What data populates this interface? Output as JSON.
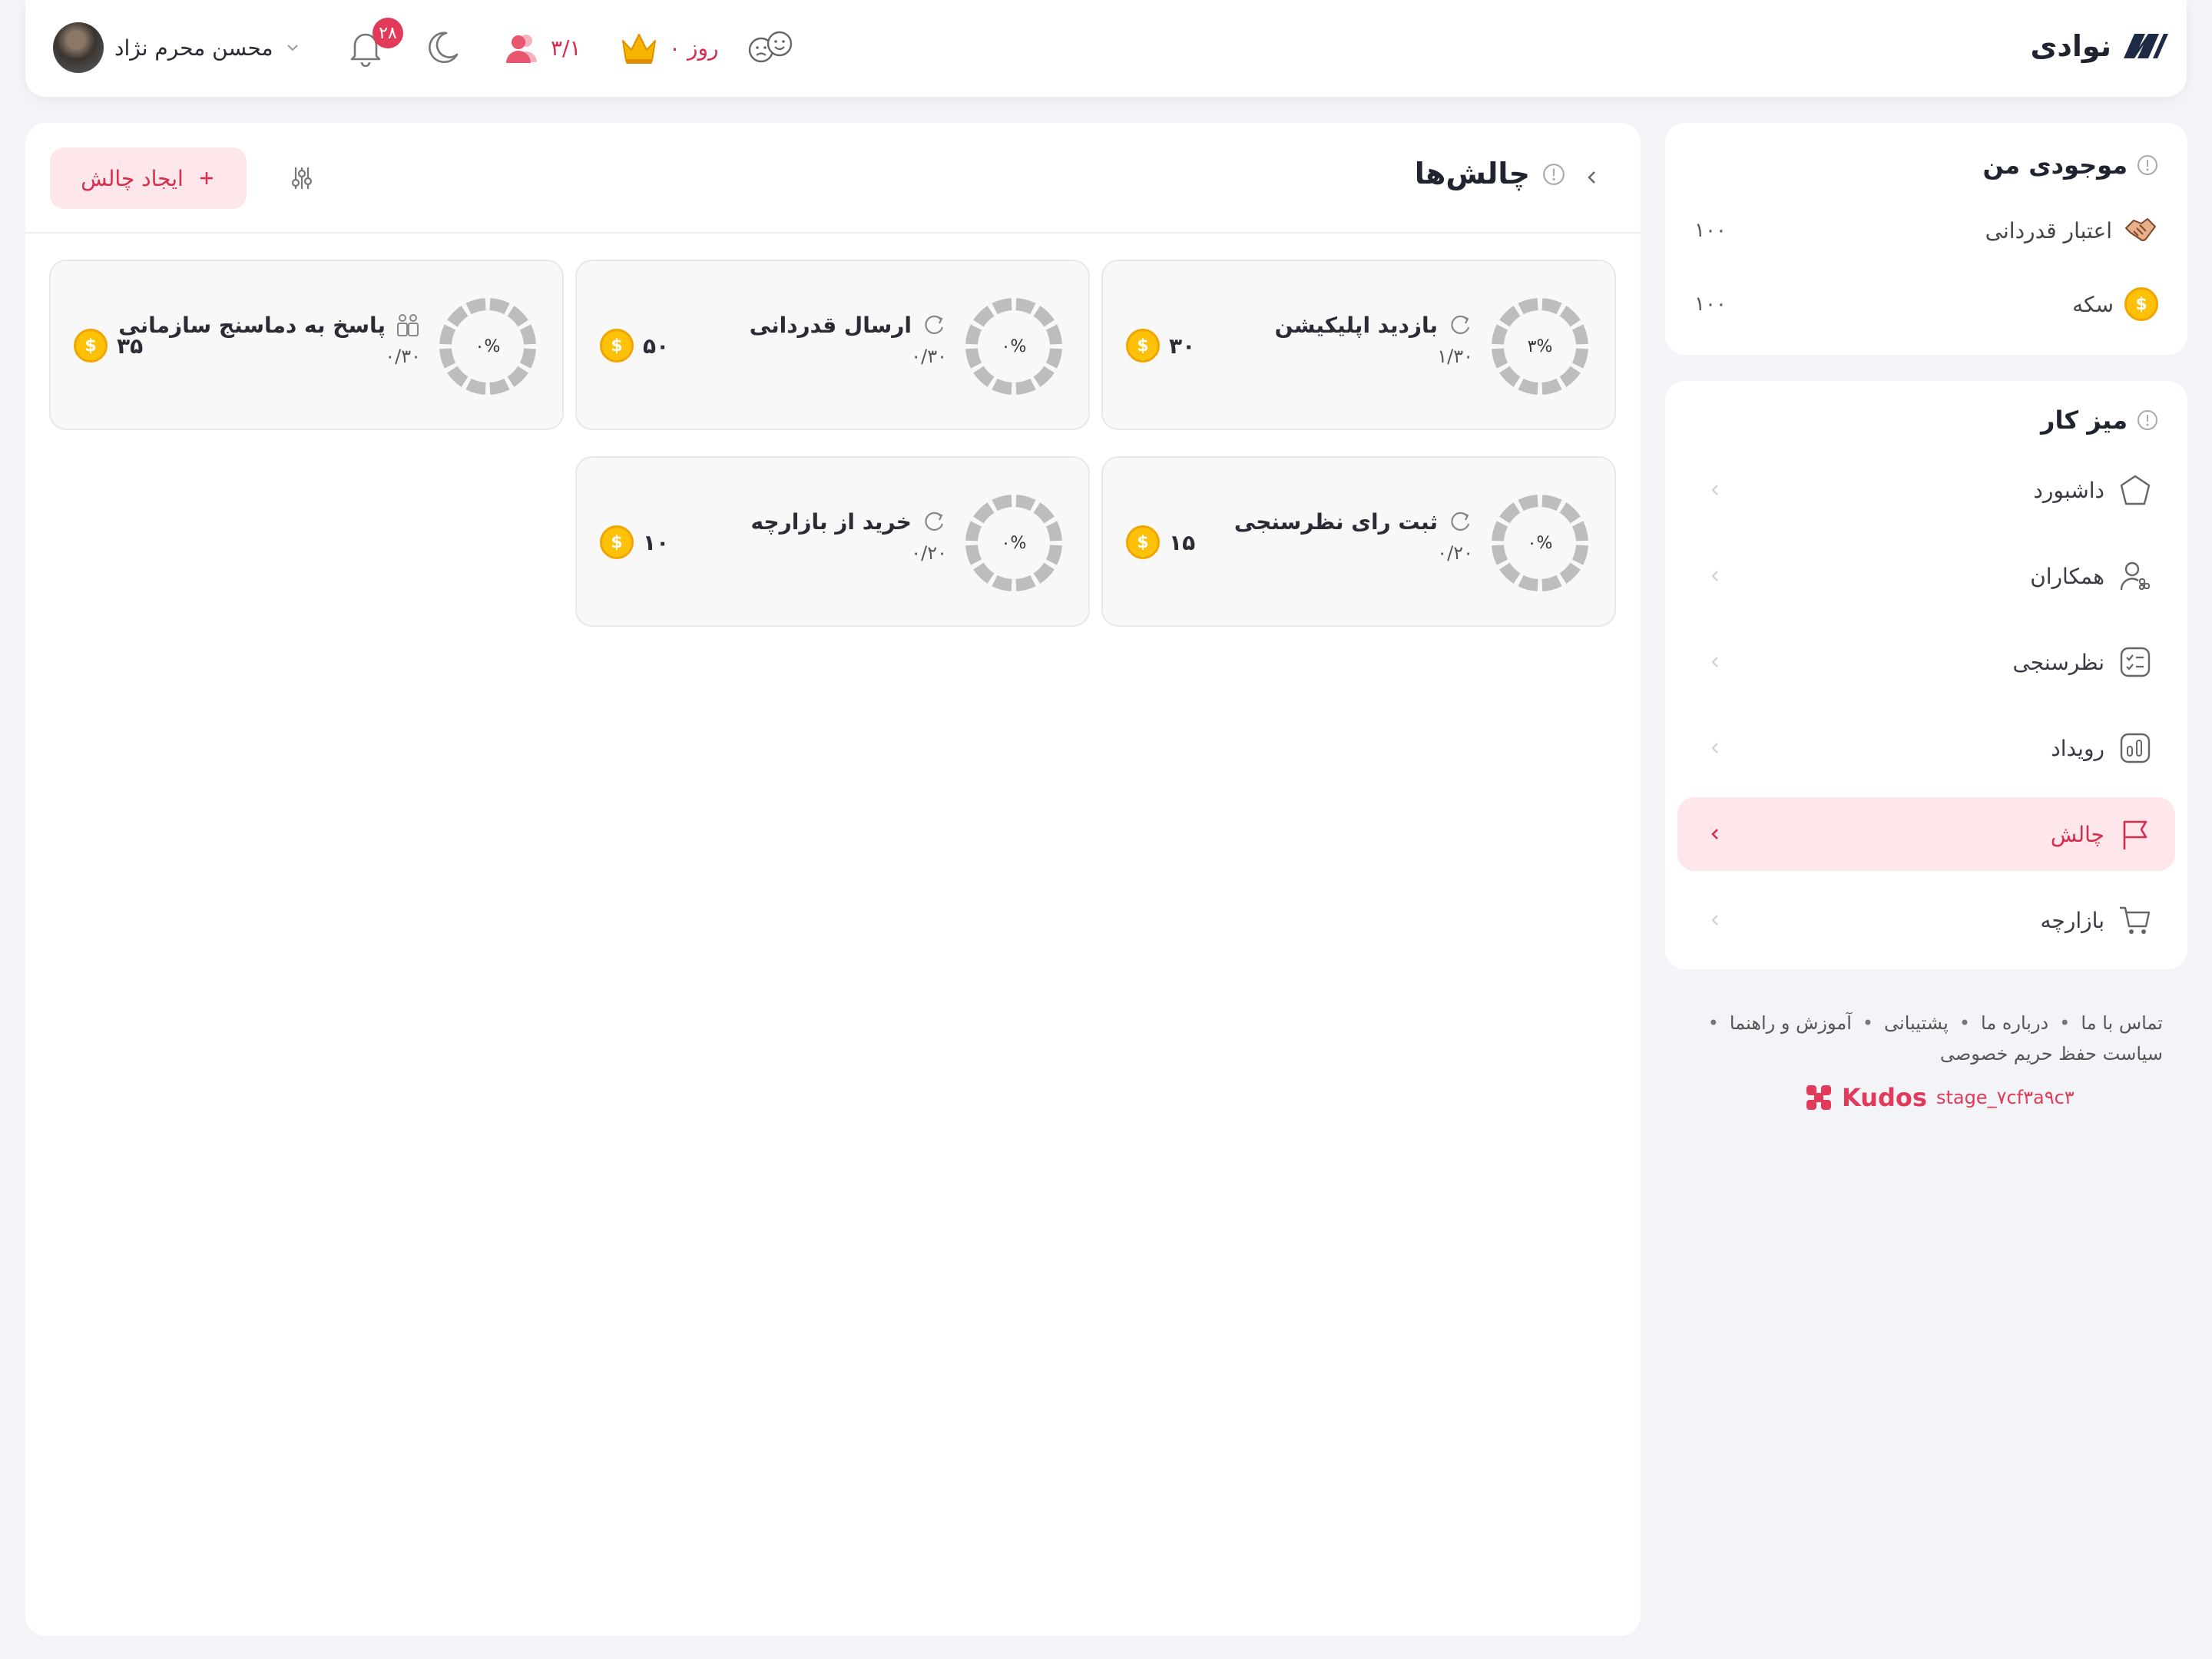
{
  "brand": {
    "name": "نوادی",
    "logo_color": "#1f2a44"
  },
  "header": {
    "user_name": "محسن محرم نژاد",
    "notifications_count": "۲۸",
    "followers": "۳/۱",
    "streak": "۰ روز"
  },
  "inventory": {
    "title": "موجودی من",
    "items": [
      {
        "label": "اعتبار قدردانی",
        "value": "۱۰۰",
        "icon": "handshake-icon"
      },
      {
        "label": "سکه",
        "value": "۱۰۰",
        "icon": "coin-icon"
      }
    ]
  },
  "workspace": {
    "title": "میز کار",
    "items": [
      {
        "label": "داشبورد",
        "icon": "home-icon"
      },
      {
        "label": "همکاران",
        "icon": "colleagues-icon"
      },
      {
        "label": "نظرسنجی",
        "icon": "survey-icon"
      },
      {
        "label": "رویداد",
        "icon": "chart-icon"
      },
      {
        "label": "چالش",
        "icon": "flag-icon",
        "active": true
      },
      {
        "label": "بازارچه",
        "icon": "cart-icon"
      }
    ]
  },
  "footer": {
    "links": [
      "تماس با ما",
      "درباره ما",
      "پشتیبانی",
      "آموزش و راهنما",
      "سیاست حفظ حریم خصوصی"
    ],
    "kudos": "Kudos",
    "version": "stage_۷cf۳a۹c۳"
  },
  "main": {
    "title": "چالش‌ها",
    "create_label": "ایجاد چالش",
    "challenges": [
      {
        "title": "بازدید اپلیکیشن",
        "progress": "۱/۳۰",
        "percent_label": "۳%",
        "percent": 3,
        "reward": "۳۰",
        "icon": "repeat-icon"
      },
      {
        "title": "ارسال قدردانی",
        "progress": "۰/۳۰",
        "percent_label": "۰%",
        "percent": 0,
        "reward": "۵۰",
        "icon": "repeat-icon"
      },
      {
        "title": "پاسخ به دماسنج سازمانی",
        "progress": "۰/۳۰",
        "percent_label": "۰%",
        "percent": 0,
        "reward": "۳۵",
        "icon": "team-icon"
      },
      {
        "title": "ثبت رای نظرسنجی",
        "progress": "۰/۲۰",
        "percent_label": "۰%",
        "percent": 0,
        "reward": "۱۵",
        "icon": "repeat-icon"
      },
      {
        "title": "خرید از بازارچه",
        "progress": "۰/۲۰",
        "percent_label": "۰%",
        "percent": 0,
        "reward": "۱۰",
        "icon": "repeat-icon"
      }
    ]
  },
  "colors": {
    "accent": "#d62d4f",
    "accent_bg": "#fde7ea",
    "coin": "#ffc107",
    "ring": "#bdbdbd"
  }
}
